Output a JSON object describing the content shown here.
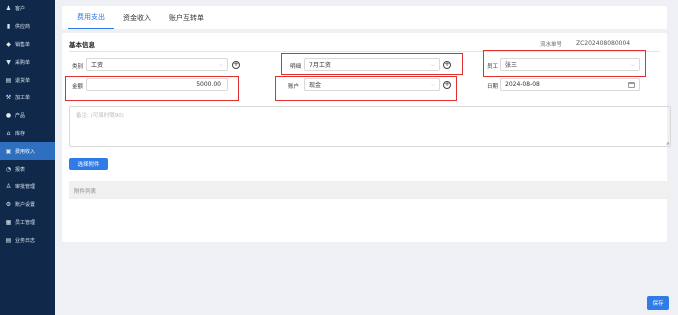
{
  "sidebar": {
    "items": [
      {
        "label": "客户",
        "icon": "customers-icon",
        "glyph": "♟",
        "active": false
      },
      {
        "label": "供应商",
        "icon": "supplier-icon",
        "glyph": "▮",
        "active": false
      },
      {
        "label": "销售单",
        "icon": "sales-icon",
        "glyph": "◆",
        "active": false
      },
      {
        "label": "采购单",
        "icon": "purchase-icon",
        "glyph": "▼",
        "active": false
      },
      {
        "label": "退货单",
        "icon": "return-icon",
        "glyph": "▤",
        "active": false
      },
      {
        "label": "加工单",
        "icon": "processing-icon",
        "glyph": "⚒",
        "active": false
      },
      {
        "label": "产品",
        "icon": "product-icon",
        "glyph": "●",
        "active": false
      },
      {
        "label": "库存",
        "icon": "inventory-icon",
        "glyph": "⌂",
        "active": false
      },
      {
        "label": "费用收入",
        "icon": "finance-icon",
        "glyph": "▣",
        "active": true
      },
      {
        "label": "报表",
        "icon": "report-icon",
        "glyph": "◔",
        "active": false
      },
      {
        "label": "审批管理",
        "icon": "approval-icon",
        "glyph": "♙",
        "active": false
      },
      {
        "label": "账户设置",
        "icon": "account-settings-icon",
        "glyph": "⚙",
        "active": false
      },
      {
        "label": "员工管理",
        "icon": "staff-icon",
        "glyph": "▦",
        "active": false
      },
      {
        "label": "业务日志",
        "icon": "log-icon",
        "glyph": "▤",
        "active": false
      }
    ]
  },
  "tabs": [
    {
      "label": "费用支出",
      "active": true
    },
    {
      "label": "资金收入",
      "active": false
    },
    {
      "label": "账户互转单",
      "active": false
    }
  ],
  "form": {
    "section_title": "基本信息",
    "serial_label": "流水单号",
    "serial_value": "ZC202408080004",
    "category_label": "类别",
    "category_value": "工资",
    "detail_label": "明细",
    "detail_value": "7月工资",
    "employee_label": "员工",
    "employee_value": "张三",
    "amount_label": "金额",
    "amount_value": "5000.00",
    "account_label": "账户",
    "account_value": "现金",
    "date_label": "日期",
    "date_value": "2024-08-08",
    "remark_placeholder": "备注: (可填时限90)",
    "attach_button": "选择附件",
    "attach_column": "附件列表"
  },
  "footer": {
    "save_label": "保存"
  },
  "colors": {
    "sidebar_bg": "#10284a",
    "sidebar_active": "#2e6fbf",
    "accent": "#2f7be8",
    "highlight": "#e03030"
  }
}
